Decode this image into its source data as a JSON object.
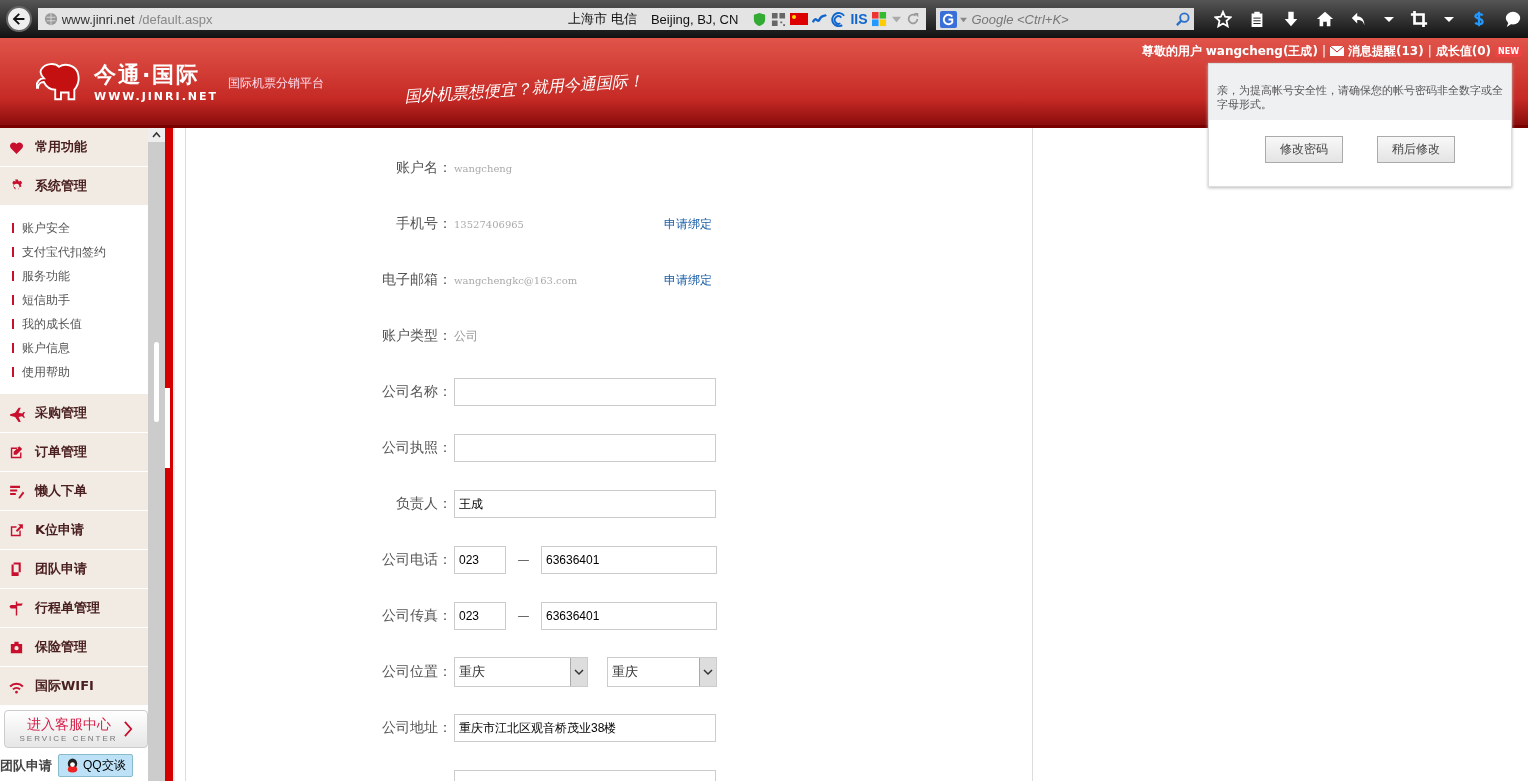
{
  "browser": {
    "url_host": "www.jinri.net",
    "url_path": "/default.aspx",
    "location": "上海市 电信",
    "geo": "Beijing, BJ, CN",
    "iis": "IIS",
    "search_placeholder": "Google <Ctrl+K>"
  },
  "header": {
    "brand": "今通·国际",
    "domain": "WWW.JINRI.NET",
    "tagline": "国际机票分销平台",
    "slogan": "国外机票想便宜？就用今通国际！",
    "user": "尊敬的用户 wangcheng(王成)",
    "separator_1": "|",
    "messages": "消息提醒(13)",
    "separator_2": "|",
    "growth": "成长值(0)",
    "badge": "NEW"
  },
  "sidebar": {
    "groups": [
      {
        "label": "常用功能"
      },
      {
        "label": "系统管理",
        "children": [
          {
            "label": "账户安全"
          },
          {
            "label": "支付宝代扣签约"
          },
          {
            "label": "服务功能"
          },
          {
            "label": "短信助手"
          },
          {
            "label": "我的成长值"
          },
          {
            "label": "账户信息"
          },
          {
            "label": "使用帮助"
          }
        ]
      },
      {
        "label": "采购管理"
      },
      {
        "label": "订单管理"
      },
      {
        "label": "懒人下单"
      },
      {
        "label": "K位申请"
      },
      {
        "label": "团队申请"
      },
      {
        "label": "行程单管理"
      },
      {
        "label": "保险管理"
      },
      {
        "label": "国际WIFI"
      }
    ],
    "service": {
      "title": "进入客服中心",
      "subtitle": "SERVICE CENTER"
    },
    "footer_label": "团队申请",
    "qq_button": "QQ交谈"
  },
  "form": {
    "rows": [
      {
        "kind": "text",
        "label": "账户名：",
        "value": "wangcheng"
      },
      {
        "kind": "text",
        "label": "手机号：",
        "value": "13527406965",
        "link": "申请绑定"
      },
      {
        "kind": "text",
        "label": "电子邮箱：",
        "value": "wangchengkc@163.com",
        "link": "申请绑定"
      },
      {
        "kind": "plain",
        "label": "账户类型：",
        "value": "公司"
      },
      {
        "kind": "input",
        "label": "公司名称："
      },
      {
        "kind": "input",
        "label": "公司执照："
      },
      {
        "kind": "input",
        "label": "负责人：",
        "value": "王成"
      },
      {
        "kind": "phone",
        "label": "公司电话：",
        "area": "023",
        "dash": "—",
        "value": "63636401"
      },
      {
        "kind": "phone",
        "label": "公司传真：",
        "area": "023",
        "dash": "—",
        "value": "63636401"
      },
      {
        "kind": "selects",
        "label": "公司位置：",
        "value": "重庆",
        "value_2": "重庆"
      },
      {
        "kind": "input",
        "label": "公司地址：",
        "value": "重庆市江北区观音桥茂业38楼"
      },
      {
        "kind": "input"
      }
    ]
  },
  "popup": {
    "message": "亲，为提高帐号安全性，请确保您的帐号密码非全数字或全字母形式。",
    "buttons": [
      "修改密码",
      "稍后修改"
    ]
  }
}
